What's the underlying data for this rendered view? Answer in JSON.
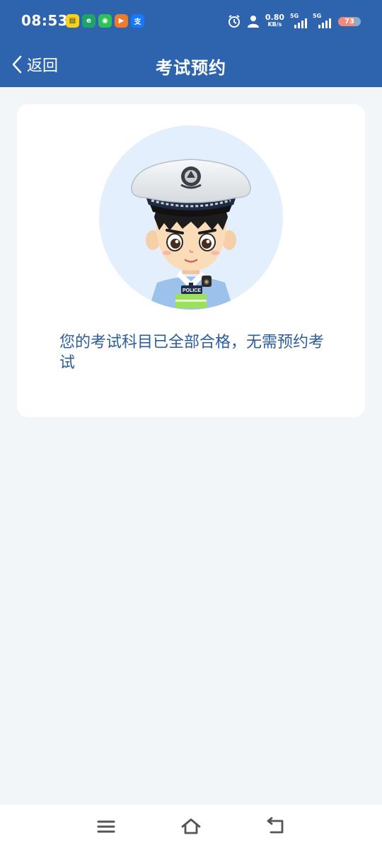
{
  "status_bar": {
    "time": "08:53",
    "notifications": [
      {
        "icon": "news-app-icon",
        "color": "#f6d21a",
        "glyph": "▤"
      },
      {
        "icon": "browser-app-icon",
        "color": "#20a36b",
        "glyph": "e"
      },
      {
        "icon": "wechat-icon",
        "color": "#2dc15a",
        "glyph": "◉"
      },
      {
        "icon": "video-app-icon",
        "color": "#f07a2c",
        "glyph": "▶"
      },
      {
        "icon": "alipay-icon",
        "color": "#1677ff",
        "glyph": "支"
      }
    ],
    "net_speed_value": "0.80",
    "net_speed_unit": "KB/s",
    "signal_1_tag": "5G",
    "signal_2_tag": "5G",
    "battery_level": "73",
    "battery_fraction": 0.73,
    "battery_color": "#f08a7a"
  },
  "navbar": {
    "back_label": "返回",
    "title": "考试预约",
    "color": "#2d64ad"
  },
  "card": {
    "illustration": "police-officer-avatar",
    "message": "您的考试科目已全部合格，无需预约考试"
  },
  "bottom_nav": {
    "menu": "menu-icon",
    "home": "home-icon",
    "back": "back-icon"
  }
}
